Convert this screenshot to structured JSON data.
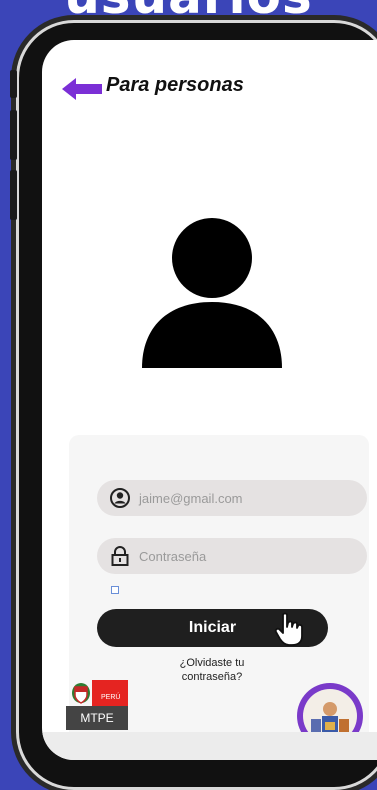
{
  "headline": "usuarios",
  "screen": {
    "title": "Para personas"
  },
  "form": {
    "email_value": "jaime@gmail.com",
    "password_placeholder": "Contraseña",
    "login_label": "Iniciar",
    "forgot_line1": "¿Olvidaste tu",
    "forgot_line2": "contraseña?"
  },
  "logo": {
    "country": "PERÚ",
    "agency": "MTPE"
  },
  "colors": {
    "background": "#3b45b8",
    "accent_arrow": "#7b2fd6",
    "button": "#1f1f1f",
    "badge": "#7a3ac9"
  },
  "icons": [
    "back-arrow-icon",
    "user-avatar-icon",
    "user-circle-icon",
    "lock-icon",
    "hand-pointer-icon"
  ]
}
